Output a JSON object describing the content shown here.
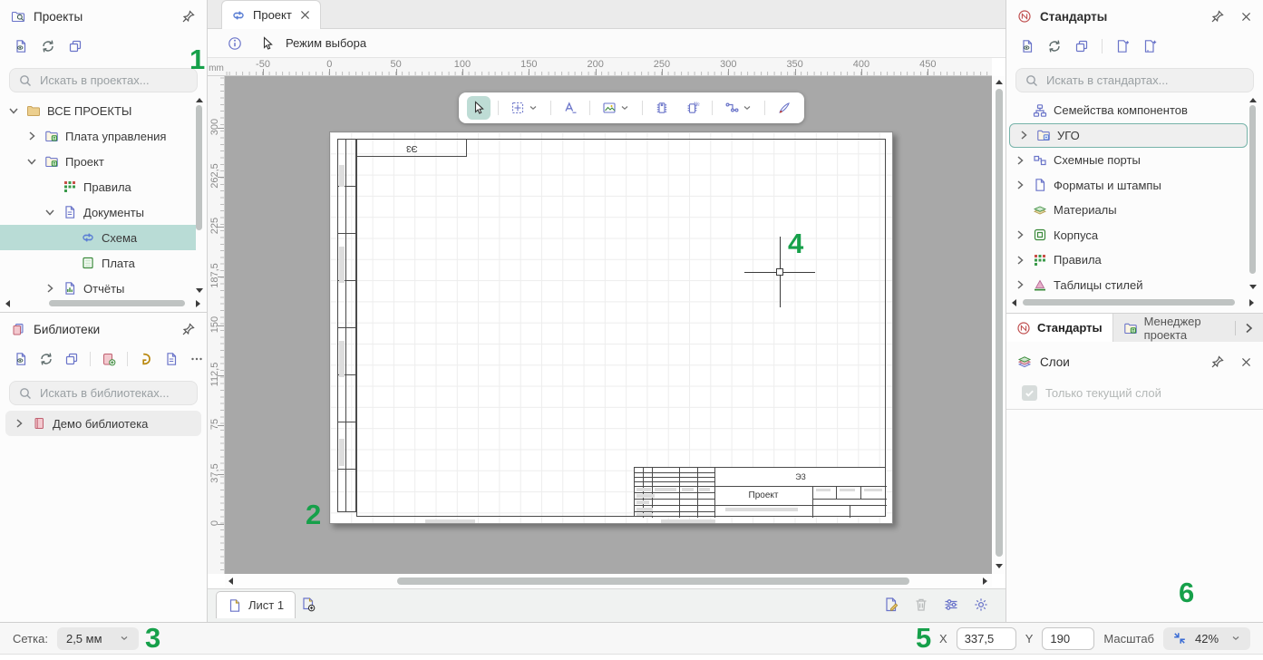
{
  "annotations": {
    "labels": [
      "1",
      "2",
      "3",
      "4",
      "5",
      "6"
    ]
  },
  "projects_panel": {
    "title": "Проекты",
    "toolbar": [
      "doc-eye",
      "refresh",
      "copy"
    ],
    "search_placeholder": "Искать в проектах...",
    "tree": [
      {
        "label": "ВСЕ ПРОЕКТЫ",
        "icon": "folder",
        "chevron": "down",
        "level": 0
      },
      {
        "label": "Плата управления",
        "icon": "project",
        "chevron": "right",
        "level": 1
      },
      {
        "label": "Проект",
        "icon": "project",
        "chevron": "down",
        "level": 1
      },
      {
        "label": "Правила",
        "icon": "rules",
        "level": 2
      },
      {
        "label": "Документы",
        "icon": "documents",
        "chevron": "down",
        "level": 2
      },
      {
        "label": "Схема",
        "icon": "schema",
        "level": 3,
        "selected": true
      },
      {
        "label": "Плата",
        "icon": "board",
        "level": 3
      },
      {
        "label": "Отчёты",
        "icon": "report",
        "chevron": "right",
        "level": 2
      }
    ]
  },
  "libraries_panel": {
    "title": "Библиотеки",
    "toolbar": [
      "doc-eye",
      "refresh",
      "copy",
      "sep",
      "book-add",
      "sep",
      "gold-d",
      "doc-import",
      "more"
    ],
    "search_placeholder": "Искать в библиотеках...",
    "tree": [
      {
        "label": "Демо библиотека",
        "icon": "book",
        "chevron": "right",
        "level": 0,
        "rowbg": true
      }
    ]
  },
  "editor": {
    "tab_label": "Проект",
    "mode_label": "Режим выбора",
    "ruler_unit": "mm",
    "h_ticks": [
      "-50",
      "0",
      "50",
      "100",
      "150",
      "200",
      "250",
      "300",
      "350",
      "400",
      "450"
    ],
    "v_ticks": [
      "300",
      "262,5",
      "225",
      "187,5",
      "150",
      "112,5",
      "75",
      "37,5",
      "0"
    ],
    "toolbar": [
      {
        "icon": "cursor",
        "selected": true
      },
      {
        "sep": true
      },
      {
        "icon": "target-box",
        "dd": true
      },
      {
        "sep": true
      },
      {
        "icon": "text-tool"
      },
      {
        "sep": true
      },
      {
        "icon": "image-tool",
        "dd": true
      },
      {
        "sep": true
      },
      {
        "icon": "chip"
      },
      {
        "icon": "chip-num"
      },
      {
        "sep": true
      },
      {
        "icon": "net",
        "dd": true
      },
      {
        "sep": true
      },
      {
        "icon": "pen"
      }
    ],
    "sheet": {
      "doc_code": "Э3",
      "title_name": "Проект"
    },
    "sheet_bar": {
      "active_tab": "Лист 1"
    }
  },
  "standards_panel": {
    "title": "Стандарты",
    "toolbar": [
      "doc-eye",
      "refresh",
      "copy",
      "sep",
      "doc-plus",
      "doc-plus2"
    ],
    "search_placeholder": "Искать в стандартах...",
    "tree": [
      {
        "label": "Семейства компонентов",
        "icon": "families",
        "level": 0
      },
      {
        "label": "УГО",
        "icon": "ugo",
        "chevron": "right",
        "level": 0,
        "selected": true
      },
      {
        "label": "Схемные порты",
        "icon": "ports",
        "chevron": "right",
        "level": 0
      },
      {
        "label": "Форматы и штампы",
        "icon": "formats",
        "chevron": "right",
        "level": 0
      },
      {
        "label": "Материалы",
        "icon": "materials",
        "level": 0
      },
      {
        "label": "Корпуса",
        "icon": "cases",
        "chevron": "right",
        "level": 0
      },
      {
        "label": "Правила",
        "icon": "rules",
        "chevron": "right",
        "level": 0
      },
      {
        "label": "Таблицы стилей",
        "icon": "styles",
        "chevron": "right",
        "level": 0
      }
    ],
    "bottom_tabs": [
      {
        "label": "Стандарты",
        "icon": "standards"
      },
      {
        "label": "Менеджер проекта",
        "icon": "manager"
      }
    ]
  },
  "layers_panel": {
    "title": "Слои",
    "only_current_label": "Только текущий слой"
  },
  "status_bar": {
    "grid_label": "Сетка:",
    "grid_value": "2,5 мм",
    "x_label": "X",
    "x_value": "337,5",
    "y_label": "Y",
    "y_value": "190",
    "scale_label": "Масштаб",
    "scale_value": "42%"
  }
}
